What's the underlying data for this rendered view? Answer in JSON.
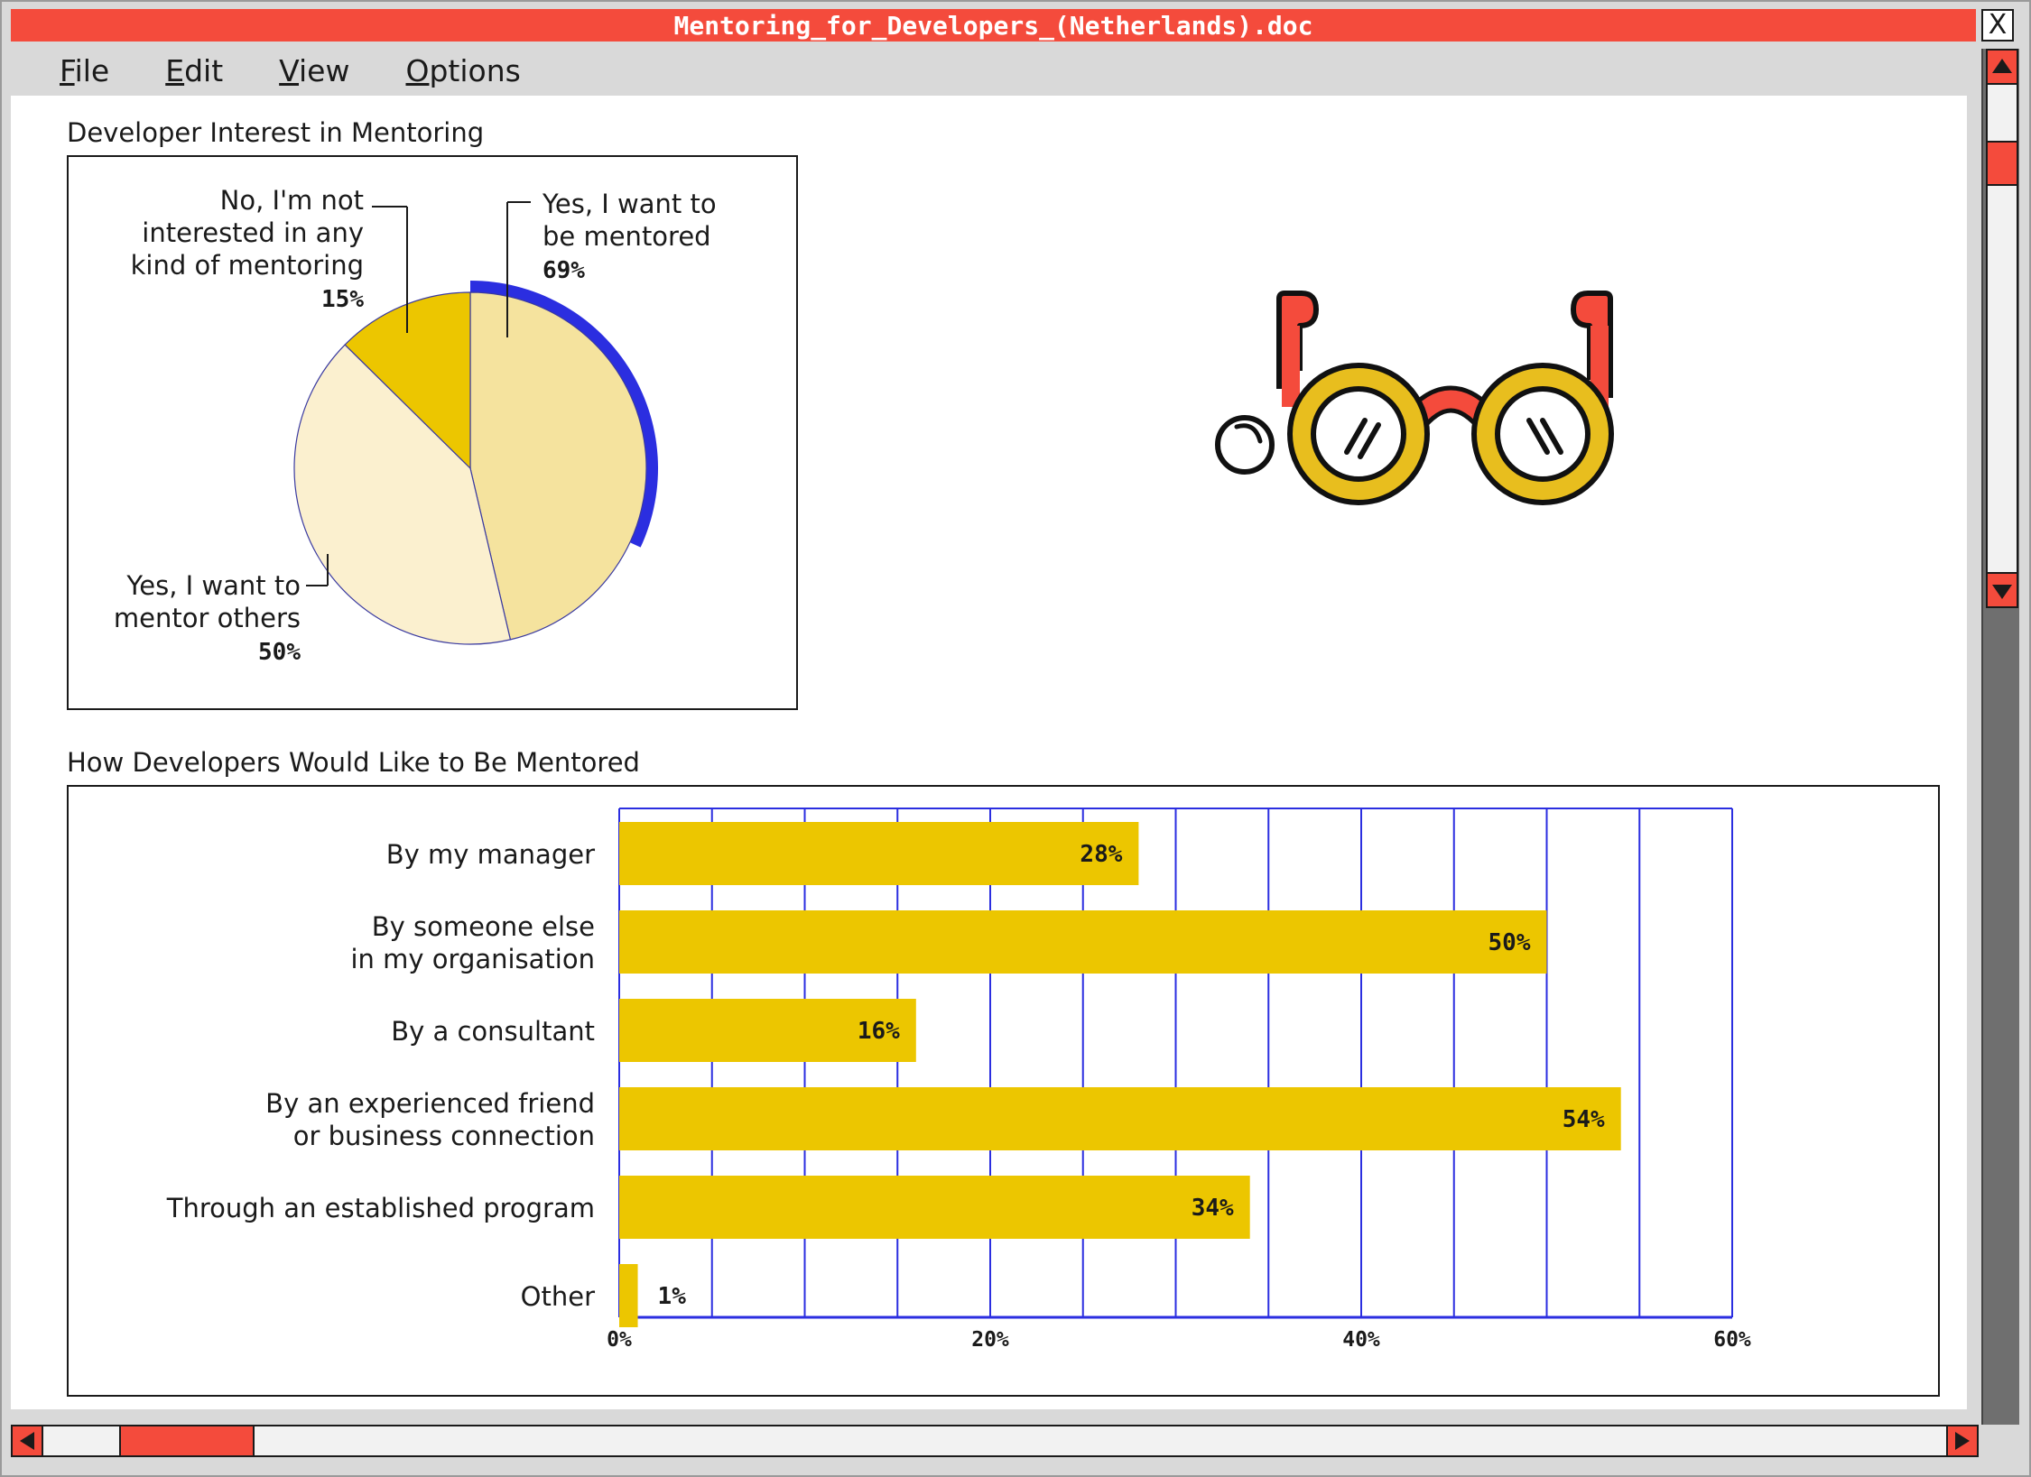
{
  "window": {
    "title": "Mentoring_for_Developers_(Netherlands).doc",
    "close_label": "X"
  },
  "menu": [
    {
      "label": "File",
      "mnemonic": "F",
      "rest": "ile"
    },
    {
      "label": "Edit",
      "mnemonic": "E",
      "rest": "dit"
    },
    {
      "label": "View",
      "mnemonic": "V",
      "rest": "iew"
    },
    {
      "label": "Options",
      "mnemonic": "O",
      "rest": "ptions"
    }
  ],
  "colors": {
    "accent": "#f44b3c",
    "bar": "#ecc600",
    "pie_light": "#f5e39e",
    "pie_lighter": "#fbf0cf",
    "pie_dark": "#ecc600",
    "ring": "#2b2ee0",
    "grid": "#2b2ee0"
  },
  "icons": {
    "illustration": "glasses-icon"
  },
  "chart_data": [
    {
      "type": "pie",
      "title": "Developer Interest in Mentoring",
      "slices": [
        {
          "label": "Yes, I want to be mentored",
          "label_lines": [
            "Yes, I want to",
            "be mentored"
          ],
          "value": 69,
          "value_label": "69%"
        },
        {
          "label": "Yes, I want to mentor others",
          "label_lines": [
            "Yes, I want to",
            "mentor others"
          ],
          "value": 50,
          "value_label": "50%"
        },
        {
          "label": "No, I'm not interested in any kind of mentoring",
          "label_lines": [
            "No, I'm not",
            "interested in any",
            "kind of mentoring"
          ],
          "value": 15,
          "value_label": "15%"
        }
      ]
    },
    {
      "type": "bar",
      "orientation": "horizontal",
      "title": "How Developers Would Like to Be Mentored",
      "categories": [
        [
          "By my manager"
        ],
        [
          "By someone else",
          "in my organisation"
        ],
        [
          "By a consultant"
        ],
        [
          "By an experienced friend",
          "or business connection"
        ],
        [
          "Through an established program"
        ],
        [
          "Other"
        ]
      ],
      "values": [
        28,
        50,
        16,
        54,
        34,
        1
      ],
      "value_labels": [
        "28%",
        "50%",
        "16%",
        "54%",
        "34%",
        "1%"
      ],
      "xlim": [
        0,
        60
      ],
      "xticks": [
        0,
        20,
        40,
        60
      ],
      "xtick_labels": [
        "0%",
        "20%",
        "40%",
        "60%"
      ],
      "grid": true
    }
  ]
}
